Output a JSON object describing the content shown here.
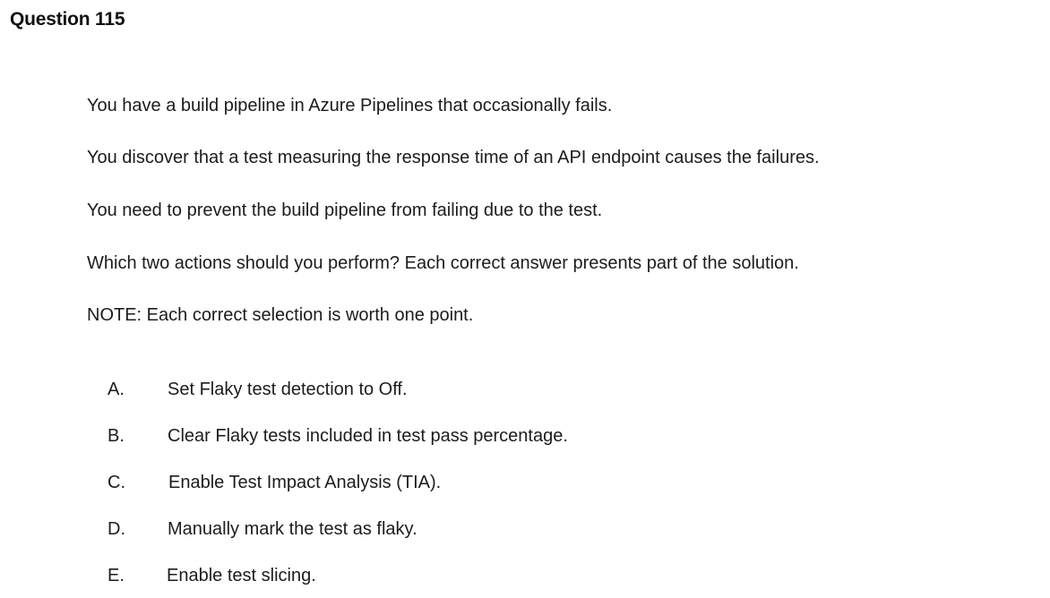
{
  "question": {
    "title": "Question 115",
    "paragraphs": [
      "You have a build pipeline in Azure Pipelines that occasionally fails.",
      "You discover that a test measuring the response time of an API endpoint causes the failures.",
      "You need to prevent the build pipeline from failing due to the test.",
      "Which two actions should you perform? Each correct answer presents part of the solution.",
      "NOTE: Each correct selection is worth one point."
    ],
    "options": [
      {
        "letter": "A.",
        "text": "Set Flaky test detection to Off."
      },
      {
        "letter": "B.",
        "text": "Clear Flaky tests included in test pass percentage."
      },
      {
        "letter": "C.",
        "text": "Enable Test Impact Analysis (TIA)."
      },
      {
        "letter": "D.",
        "text": "Manually mark the test as flaky."
      },
      {
        "letter": "E.",
        "text": "Enable test slicing."
      }
    ]
  }
}
